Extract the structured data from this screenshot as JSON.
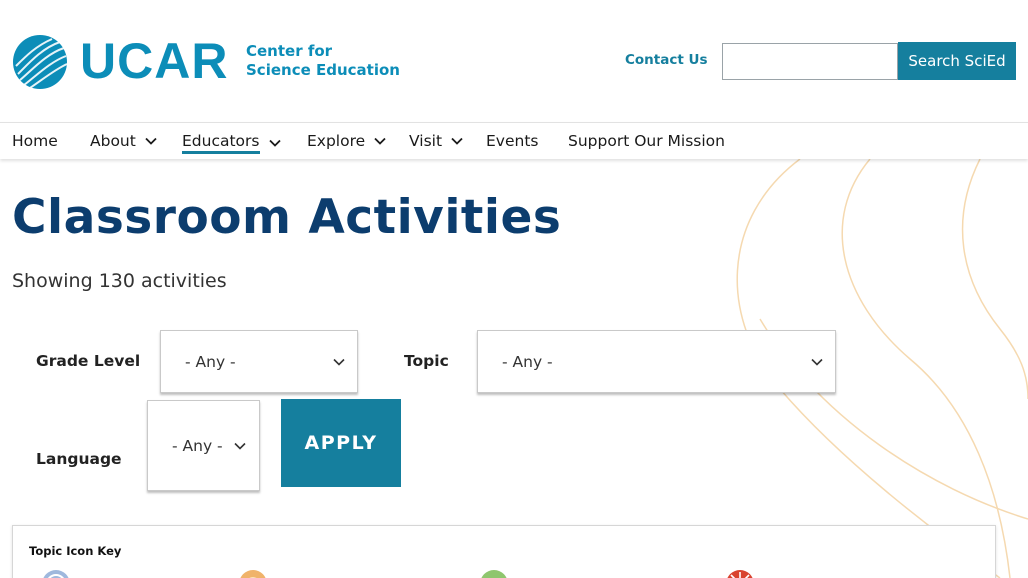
{
  "header": {
    "logo_text": "UCAR",
    "logo_sub_line1": "Center for",
    "logo_sub_line2": "Science Education",
    "contact_label": "Contact Us",
    "search_placeholder": "",
    "search_button_label": "Search SciEd"
  },
  "nav": {
    "items": [
      {
        "label": "Home"
      },
      {
        "label": "About"
      },
      {
        "label": "Educators"
      },
      {
        "label": "Explore"
      },
      {
        "label": "Visit"
      },
      {
        "label": "Events"
      },
      {
        "label": "Support Our Mission"
      }
    ]
  },
  "main": {
    "title": "Classroom Activities",
    "count_text": "Showing 130 activities",
    "filters": {
      "grade_label": "Grade Level",
      "grade_value": "- Any -",
      "topic_label": "Topic",
      "topic_value": "- Any -",
      "language_label": "Language",
      "language_value": "- Any -"
    },
    "apply_label": "APPLY",
    "topic_key_title": "Topic Icon Key"
  },
  "colors": {
    "brand": "#0c8db8",
    "button": "#157f9e",
    "title": "#0c3d6e",
    "swoosh": "#f5d9b0"
  },
  "icons": {
    "logo": "ucar-globe-icon",
    "chevron": "chevron-down-icon",
    "key_icons": [
      "atmosphere-topic-icon",
      "sun-topic-icon",
      "biosphere-topic-icon",
      "energy-topic-icon"
    ]
  }
}
